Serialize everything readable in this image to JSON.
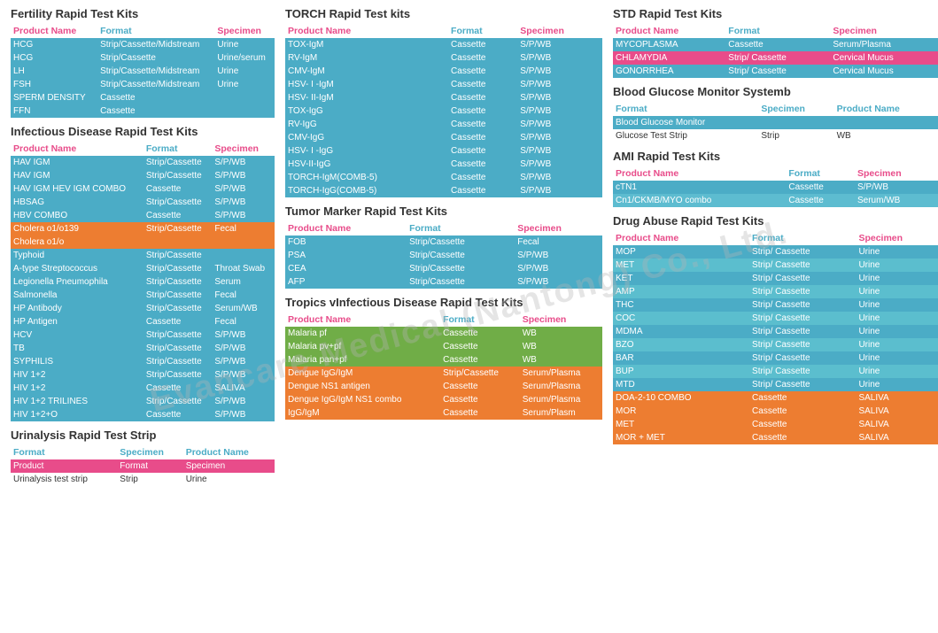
{
  "watermark": "Evancare Medical (Nantong) Co., Ltd.",
  "sections": {
    "col1": {
      "fertility": {
        "title": "Fertility Rapid Test Kits",
        "headers": [
          "Product Name",
          "Format",
          "Specimen"
        ],
        "rows": [
          [
            "HCG",
            "Strip/Cassette/Midstream",
            "Urine"
          ],
          [
            "HCG",
            "Strip/Cassette",
            "Urine/serum"
          ],
          [
            "LH",
            "Strip/Cassette/Midstream",
            "Urine"
          ],
          [
            "FSH",
            "Strip/Cassette/Midstream",
            "Urine"
          ],
          [
            "SPERM DENSITY",
            "Cassette",
            ""
          ],
          [
            "FFN",
            "Cassette",
            ""
          ]
        ]
      },
      "infectious": {
        "title": "Infectious Disease Rapid Test Kits",
        "headers": [
          "Product Name",
          "Format",
          "Specimen"
        ],
        "rows": [
          [
            "HAV IGM",
            "Strip/Cassette",
            "S/P/WB"
          ],
          [
            "HAV IGM",
            "Strip/Cassette",
            "S/P/WB"
          ],
          [
            "HAV IGM HEV IGM COMBO",
            "Cassette",
            "S/P/WB"
          ],
          [
            "HBSAG",
            "Strip/Cassette",
            "S/P/WB"
          ],
          [
            "HBV COMBO",
            "Cassette",
            "S/P/WB"
          ],
          [
            "Cholera o1/o139",
            "Strip/Cassette",
            "Fecal"
          ],
          [
            "Cholera o1/o",
            "",
            ""
          ],
          [
            "Typhoid",
            "Strip/Cassette",
            ""
          ],
          [
            "A-type Streptococcus",
            "Strip/Cassette",
            "Throat Swab"
          ],
          [
            "Legionella Pneumophila",
            "Strip/Cassette",
            "Serum"
          ],
          [
            "Salmonella",
            "Strip/Cassette",
            "Fecal"
          ],
          [
            "HP Antibody",
            "Strip/Cassette",
            "Serum/WB"
          ],
          [
            "HP Antigen",
            "Cassette",
            "Fecal"
          ],
          [
            "HCV",
            "Strip/Cassette",
            "S/P/WB"
          ],
          [
            "TB",
            "Strip/Cassette",
            "S/P/WB"
          ],
          [
            "SYPHILIS",
            "Strip/Cassette",
            "S/P/WB"
          ],
          [
            "HIV 1+2",
            "Strip/Cassette",
            "S/P/WB"
          ],
          [
            "HIV 1+2",
            "Cassette",
            "SALIVA"
          ],
          [
            "HIV 1+2 TRILINES",
            "Strip/Cassette",
            "S/P/WB"
          ],
          [
            "HIV 1+2+O",
            "Cassette",
            "S/P/WB"
          ]
        ]
      },
      "urinalysis": {
        "title": "Urinalysis Rapid Test Strip",
        "headers": [
          "Format",
          "Specimen",
          "Product Name"
        ],
        "rows": [
          [
            "Product",
            "Format",
            "Specimen"
          ],
          [
            "Urinalysis test strip",
            "Strip",
            "Urine"
          ]
        ]
      }
    },
    "col2": {
      "torch": {
        "title": "TORCH Rapid Test kits",
        "headers": [
          "Product Name",
          "Format",
          "Specimen"
        ],
        "rows": [
          [
            "TOX-IgM",
            "Cassette",
            "S/P/WB"
          ],
          [
            "RV-IgM",
            "Cassette",
            "S/P/WB"
          ],
          [
            "CMV-IgM",
            "Cassette",
            "S/P/WB"
          ],
          [
            "HSV- I -IgM",
            "Cassette",
            "S/P/WB"
          ],
          [
            "HSV- II-IgM",
            "Cassette",
            "S/P/WB"
          ],
          [
            "TOX-IgG",
            "Cassette",
            "S/P/WB"
          ],
          [
            "RV-IgG",
            "Cassette",
            "S/P/WB"
          ],
          [
            "CMV-IgG",
            "Cassette",
            "S/P/WB"
          ],
          [
            "HSV- I -IgG",
            "Cassette",
            "S/P/WB"
          ],
          [
            "HSV-II-IgG",
            "Cassette",
            "S/P/WB"
          ],
          [
            "TORCH-IgM(COMB-5)",
            "Cassette",
            "S/P/WB"
          ],
          [
            "TORCH-IgG(COMB-5)",
            "Cassette",
            "S/P/WB"
          ]
        ]
      },
      "tumor": {
        "title": "Tumor Marker Rapid Test Kits",
        "headers": [
          "Product Name",
          "Format",
          "Specimen"
        ],
        "rows": [
          [
            "FOB",
            "Strip/Cassette",
            "Fecal"
          ],
          [
            "PSA",
            "Strip/Cassette",
            "S/P/WB"
          ],
          [
            "CEA",
            "Strip/Cassette",
            "S/P/WB"
          ],
          [
            "AFP",
            "Strip/Cassette",
            "S/P/WB"
          ]
        ]
      },
      "tropics": {
        "title": "Tropics vInfectious Disease Rapid Test Kits",
        "headers": [
          "Product Name",
          "Format",
          "Specimen"
        ],
        "rows": [
          [
            "Malaria pf",
            "Cassette",
            "WB"
          ],
          [
            "Malaria pv+pf",
            "Cassette",
            "WB"
          ],
          [
            "Malaria pan+pf",
            "Cassette",
            "WB"
          ],
          [
            "Dengue IgG/IgM",
            "Strip/Cassette",
            "Serum/Plasma"
          ],
          [
            "Dengue NS1 antigen",
            "Cassette",
            "Serum/Plasma"
          ],
          [
            "Dengue IgG/IgM NS1 combo",
            "Cassette",
            "Serum/Plasma"
          ],
          [
            "IgG/IgM",
            "Cassette",
            "Serum/Plasm"
          ]
        ]
      }
    },
    "col3": {
      "std": {
        "title": "STD Rapid Test Kits",
        "headers": [
          "Product Name",
          "Format",
          "Specimen"
        ],
        "rows": [
          [
            "MYCOPLASMA",
            "Cassette",
            "Serum/Plasma"
          ],
          [
            "CHLAMYDIA",
            "Strip/ Cassette",
            "Cervical Mucus"
          ],
          [
            "GONORRHEA",
            "Strip/ Cassette",
            "Cervical Mucus"
          ]
        ]
      },
      "bloodGlucose": {
        "title": "Blood Glucose Monitor Systemb",
        "headers": [
          "Format",
          "Specimen",
          "Product Name"
        ],
        "rows": [
          [
            "Blood Glucose Monitor",
            "",
            ""
          ],
          [
            "Glucose Test Strip",
            "Strip",
            "WB"
          ]
        ]
      },
      "ami": {
        "title": "AMI  Rapid Test Kits",
        "headers": [
          "Product Name",
          "Format",
          "Specimen"
        ],
        "rows": [
          [
            "cTN1",
            "Cassette",
            "S/P/WB"
          ],
          [
            "Cn1/CKMB/MYO combo",
            "Cassette",
            "Serum/WB"
          ]
        ]
      },
      "drugAbuse": {
        "title": "Drug Abuse Rapid Test Kits",
        "headers": [
          "Product Name",
          "Format",
          "Specimen"
        ],
        "rows": [
          [
            "MOP",
            "Strip/ Cassette",
            "Urine"
          ],
          [
            "MET",
            "Strip/ Cassette",
            "Urine"
          ],
          [
            "KET",
            "Strip/ Cassette",
            "Urine"
          ],
          [
            "AMP",
            "Strip/ Cassette",
            "Urine"
          ],
          [
            "THC",
            "Strip/ Cassette",
            "Urine"
          ],
          [
            "COC",
            "Strip/ Cassette",
            "Urine"
          ],
          [
            "MDMA",
            "Strip/ Cassette",
            "Urine"
          ],
          [
            "BZO",
            "Strip/ Cassette",
            "Urine"
          ],
          [
            "BAR",
            "Strip/ Cassette",
            "Urine"
          ],
          [
            "BUP",
            "Strip/ Cassette",
            "Urine"
          ],
          [
            "MTD",
            "Strip/ Cassette",
            "Urine"
          ],
          [
            "DOA-2-10 COMBO",
            "Cassette",
            "SALIVA"
          ],
          [
            "MOR",
            "Cassette",
            "SALIVA"
          ],
          [
            "MET",
            "Cassette",
            "SALIVA"
          ],
          [
            "MOR + MET",
            "Cassette",
            "SALIVA"
          ]
        ]
      }
    }
  }
}
